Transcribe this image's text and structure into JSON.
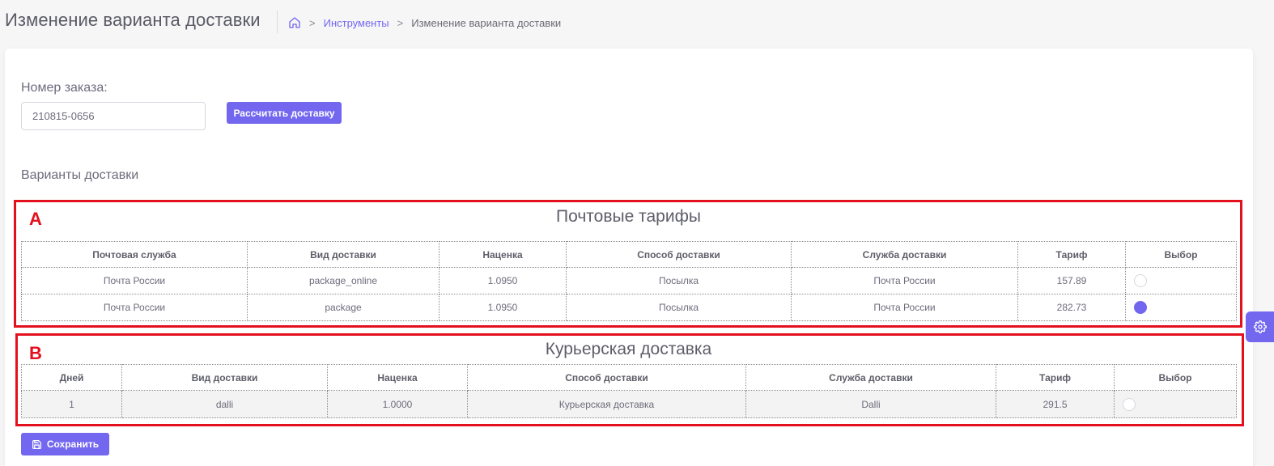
{
  "header": {
    "title": "Изменение варианта доставки",
    "breadcrumb": {
      "home_icon": "home-icon",
      "separator": ">",
      "link": "Инструменты",
      "current": "Изменение варианта доставки"
    }
  },
  "order": {
    "label": "Номер заказа:",
    "value": "210815-0656",
    "calc_button": "Рассчитать доставку"
  },
  "variants_label": "Варианты доставки",
  "annotations": {
    "a": "A",
    "b": "B",
    "color": "#e3101d"
  },
  "postal": {
    "title": "Почтовые тарифы",
    "columns": [
      "Почтовая служба",
      "Вид доставки",
      "Наценка",
      "Способ доставки",
      "Служба доставки",
      "Тариф",
      "Выбор"
    ],
    "rows": [
      {
        "service": "Почта России",
        "type": "package_online",
        "markup": "1.0950",
        "method": "Посылка",
        "carrier": "Почта России",
        "tariff": "157.89",
        "selected": false
      },
      {
        "service": "Почта России",
        "type": "package",
        "markup": "1.0950",
        "method": "Посылка",
        "carrier": "Почта России",
        "tariff": "282.73",
        "selected": true
      }
    ]
  },
  "courier": {
    "title": "Курьерская доставка",
    "columns": [
      "Дней",
      "Вид доставки",
      "Наценка",
      "Способ доставки",
      "Служба доставки",
      "Тариф",
      "Выбор"
    ],
    "rows": [
      {
        "days": "1",
        "type": "dalli",
        "markup": "1.0000",
        "method": "Курьерская доставка",
        "carrier": "Dalli",
        "tariff": "291.5",
        "selected": false
      }
    ]
  },
  "save_button": {
    "label": "Сохранить",
    "icon": "save-icon"
  },
  "settings": {
    "icon": "gear-icon"
  },
  "colors": {
    "accent": "#7367f0",
    "text": "#6e6b7b",
    "background": "#f6f6f7"
  }
}
